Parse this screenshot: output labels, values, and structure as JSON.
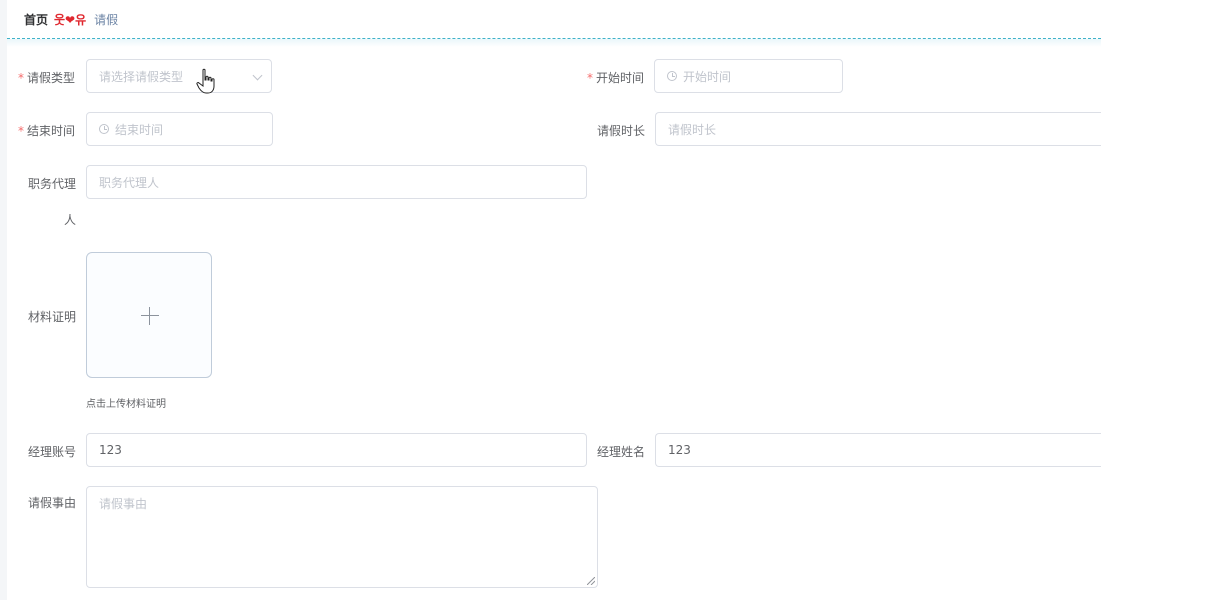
{
  "breadcrumb": {
    "home": "首页",
    "separator": "웃❤유",
    "current": "请假"
  },
  "form": {
    "leave_type": {
      "label": "请假类型",
      "required": "*",
      "placeholder": "请选择请假类型"
    },
    "start_time": {
      "label": "开始时间",
      "required": "*",
      "placeholder": "开始时间"
    },
    "end_time": {
      "label": "结束时间",
      "required": "*",
      "placeholder": "结束时间"
    },
    "duration": {
      "label": "请假时长",
      "placeholder": "请假时长"
    },
    "deputy": {
      "label_line1": "职务代理",
      "label_line2": "人",
      "placeholder": "职务代理人"
    },
    "material": {
      "label": "材料证明",
      "tip": "点击上传材料证明"
    },
    "manager_account": {
      "label": "经理账号",
      "value": "123"
    },
    "manager_name": {
      "label": "经理姓名",
      "value": "123"
    },
    "reason": {
      "label": "请假事由",
      "placeholder": "请假事由"
    }
  },
  "icons": {
    "clock": "clock-icon",
    "chevron": "chevron-down-icon",
    "plus": "plus-icon",
    "cursor": "hand-pointer-icon"
  },
  "colors": {
    "required": "#f56c6c",
    "breadcrumb_separator": "#e0282f",
    "divider": "#3fb2c9"
  }
}
